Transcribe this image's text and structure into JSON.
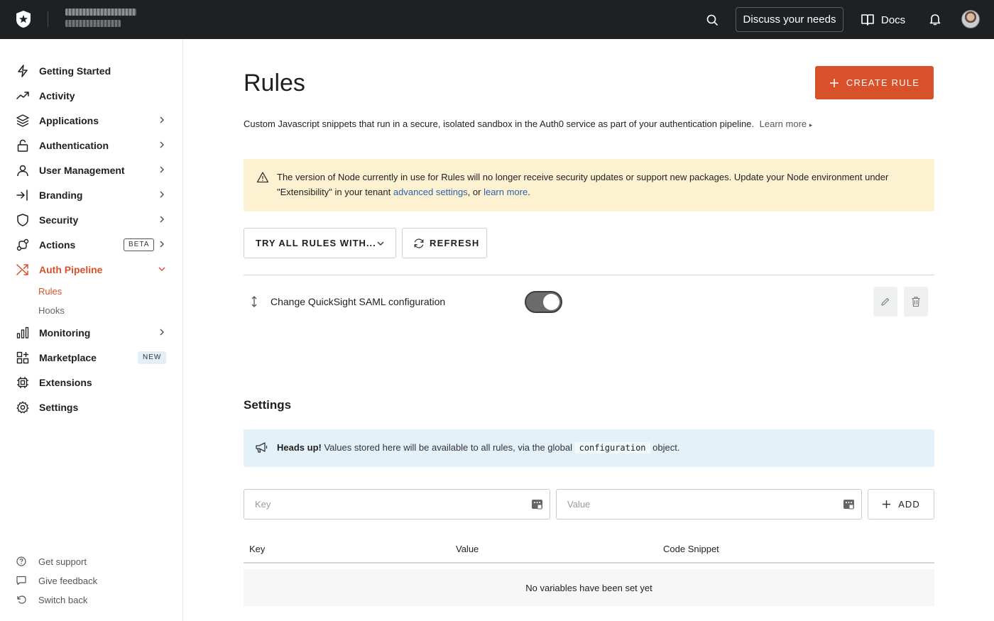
{
  "topbar": {
    "discuss_label": "Discuss your needs",
    "docs_label": "Docs"
  },
  "sidebar": {
    "items": [
      {
        "label": "Getting Started",
        "icon": "bolt-icon"
      },
      {
        "label": "Activity",
        "icon": "trending-icon"
      },
      {
        "label": "Applications",
        "icon": "layers-icon"
      },
      {
        "label": "Authentication",
        "icon": "unlock-icon"
      },
      {
        "label": "User Management",
        "icon": "user-icon"
      },
      {
        "label": "Branding",
        "icon": "login-icon"
      },
      {
        "label": "Security",
        "icon": "shield-icon"
      },
      {
        "label": "Actions",
        "icon": "actions-icon",
        "badge": "BETA"
      },
      {
        "label": "Auth Pipeline",
        "icon": "shuffle-icon"
      },
      {
        "label": "Monitoring",
        "icon": "bar-chart-icon"
      },
      {
        "label": "Marketplace",
        "icon": "grid-plus-icon",
        "badge": "NEW"
      },
      {
        "label": "Extensions",
        "icon": "chip-icon"
      },
      {
        "label": "Settings",
        "icon": "gear-icon"
      }
    ],
    "subitems": [
      "Rules",
      "Hooks"
    ],
    "footer": [
      "Get support",
      "Give feedback",
      "Switch back"
    ]
  },
  "main": {
    "title": "Rules",
    "create_label": "CREATE RULE",
    "description": "Custom Javascript snippets that run in a secure, isolated sandbox in the Auth0 service as part of your authentication pipeline.",
    "learn_more": "Learn more",
    "warning": {
      "text_before": "The version of Node currently in use for Rules will no longer receive security updates or support new packages. Update your Node environment under \"Extensibility\" in your tenant ",
      "link1": "advanced settings",
      "text_middle": ", or ",
      "link2": "learn more",
      "text_after": "."
    },
    "try_label": "TRY ALL RULES WITH...",
    "refresh_label": "REFRESH",
    "rules": [
      {
        "name": "Change QuickSight SAML configuration",
        "enabled": true
      }
    ]
  },
  "settings": {
    "title": "Settings",
    "heads_up": "Heads up!",
    "info_before": "Values stored here will be available to all rules, via the global",
    "info_code": "configuration",
    "info_after": "object.",
    "key_placeholder": "Key",
    "value_placeholder": "Value",
    "add_label": "ADD",
    "columns": [
      "Key",
      "Value",
      "Code Snippet"
    ],
    "empty_text": "No variables have been set yet"
  },
  "colors": {
    "accent": "#d8512b",
    "topbar": "#1e2124",
    "warning_bg": "#fcf2d2",
    "info_bg": "#e3f1f8"
  }
}
